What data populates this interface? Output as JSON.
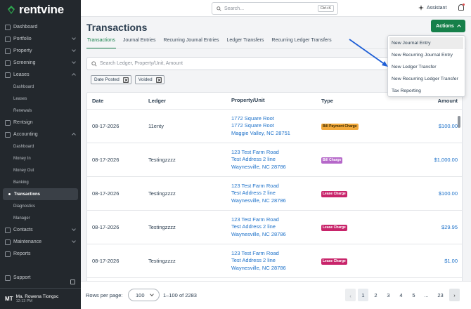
{
  "app": {
    "logo_text": "rentvine"
  },
  "sidebar": {
    "items": [
      {
        "label": "Dashboard",
        "icon": "dashboard-icon"
      },
      {
        "label": "Portfolio",
        "icon": "portfolio-icon",
        "chevron": "down"
      },
      {
        "label": "Property",
        "icon": "property-icon",
        "chevron": "down"
      },
      {
        "label": "Screening",
        "icon": "screening-icon",
        "chevron": "down"
      },
      {
        "label": "Leases",
        "icon": "leases-icon",
        "chevron": "up"
      }
    ],
    "lease_sub": [
      "Dashboard",
      "Leases",
      "Renewals"
    ],
    "rentsign": "Rentsign",
    "accounting": "Accounting",
    "accounting_sub": [
      "Dashboard",
      "Money In",
      "Money Out",
      "Banking",
      "Transactions",
      "Diagnostics",
      "Manager"
    ],
    "contacts": "Contacts",
    "maintenance": "Maintenance",
    "reports": "Reports",
    "support": "Support",
    "user": {
      "initials": "MT",
      "name": "Ma. Rowena Tiongsc",
      "time": "12:13 PM"
    }
  },
  "topbar": {
    "search_placeholder": "Search...",
    "shortcut": "Ctrl+K",
    "assistant": "Assistant"
  },
  "page": {
    "title": "Transactions",
    "actions_label": "Actions",
    "tabs": [
      "Transactions",
      "Journal Entries",
      "Recurring Journal Entries",
      "Ledger Transfers",
      "Recurring Ledger Transfers"
    ],
    "filter_placeholder": "Search Ledger, Property/Unit, Amount",
    "chips": [
      "Date Posted",
      "Voided"
    ]
  },
  "table": {
    "headers": {
      "date": "Date",
      "ledger": "Ledger",
      "property": "Property/Unit",
      "type": "Type",
      "amount": "Amount"
    },
    "rows": [
      {
        "date": "08-17-2026",
        "ledger": "11enty",
        "addr1": "1772 Square Root",
        "addr2": "1772 Square Root",
        "addr3": "Maggie Valley, NC 28751",
        "type": "Bill Payment Charge",
        "type_color": "#f2a93b",
        "type_text": "#3a2a00",
        "amount": "$100.00"
      },
      {
        "date": "08-17-2026",
        "ledger": "Testingzzzz",
        "addr1": "123 Test Farm Road",
        "addr2": "Test Address 2 line",
        "addr3": "Waynesville, NC 28786",
        "type": "Bill Charge",
        "type_color": "#b567c9",
        "type_text": "#ffffff",
        "amount": "$1,000.00"
      },
      {
        "date": "08-17-2026",
        "ledger": "Testingzzzz",
        "addr1": "123 Test Farm Road",
        "addr2": "Test Address 2 line",
        "addr3": "Waynesville, NC 28786",
        "type": "Lease Charge",
        "type_color": "#c8246a",
        "type_text": "#ffffff",
        "amount": "$100.00"
      },
      {
        "date": "08-17-2026",
        "ledger": "Testingzzzz",
        "addr1": "123 Test Farm Road",
        "addr2": "Test Address 2 line",
        "addr3": "Waynesville, NC 28786",
        "type": "Lease Charge",
        "type_color": "#c8246a",
        "type_text": "#ffffff",
        "amount": "$29.95"
      },
      {
        "date": "08-17-2026",
        "ledger": "Testingzzzz",
        "addr1": "123 Test Farm Road",
        "addr2": "Test Address 2 line",
        "addr3": "Waynesville, NC 28786",
        "type": "Lease Charge",
        "type_color": "#c8246a",
        "type_text": "#ffffff",
        "amount": "$1.00"
      }
    ]
  },
  "footer": {
    "rows_per_page_label": "Rows per page:",
    "rows_per_page": "100",
    "range": "1–100 of 2283",
    "pages": [
      "1",
      "2",
      "3",
      "4",
      "5",
      "...",
      "23"
    ]
  },
  "dropdown": {
    "items": [
      "New Journal Entry",
      "New Recurring Journal Entry",
      "New Ledger Transfer",
      "New Recurring Ledger Transfer",
      "Tax Reporting"
    ]
  },
  "colors": {
    "brand_green": "#16804a",
    "link_blue": "#1d71c9",
    "annotation_arrow": "#1f5fd6",
    "sidebar_bg": "#23282d"
  }
}
